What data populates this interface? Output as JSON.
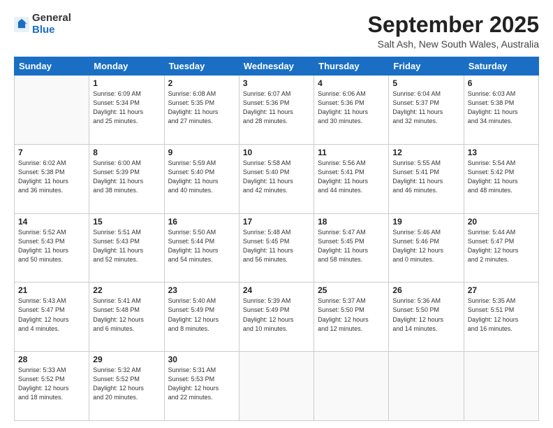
{
  "logo": {
    "general": "General",
    "blue": "Blue"
  },
  "header": {
    "month": "September 2025",
    "location": "Salt Ash, New South Wales, Australia"
  },
  "weekdays": [
    "Sunday",
    "Monday",
    "Tuesday",
    "Wednesday",
    "Thursday",
    "Friday",
    "Saturday"
  ],
  "weeks": [
    [
      {
        "day": "",
        "info": ""
      },
      {
        "day": "1",
        "info": "Sunrise: 6:09 AM\nSunset: 5:34 PM\nDaylight: 11 hours\nand 25 minutes."
      },
      {
        "day": "2",
        "info": "Sunrise: 6:08 AM\nSunset: 5:35 PM\nDaylight: 11 hours\nand 27 minutes."
      },
      {
        "day": "3",
        "info": "Sunrise: 6:07 AM\nSunset: 5:36 PM\nDaylight: 11 hours\nand 28 minutes."
      },
      {
        "day": "4",
        "info": "Sunrise: 6:06 AM\nSunset: 5:36 PM\nDaylight: 11 hours\nand 30 minutes."
      },
      {
        "day": "5",
        "info": "Sunrise: 6:04 AM\nSunset: 5:37 PM\nDaylight: 11 hours\nand 32 minutes."
      },
      {
        "day": "6",
        "info": "Sunrise: 6:03 AM\nSunset: 5:38 PM\nDaylight: 11 hours\nand 34 minutes."
      }
    ],
    [
      {
        "day": "7",
        "info": "Sunrise: 6:02 AM\nSunset: 5:38 PM\nDaylight: 11 hours\nand 36 minutes."
      },
      {
        "day": "8",
        "info": "Sunrise: 6:00 AM\nSunset: 5:39 PM\nDaylight: 11 hours\nand 38 minutes."
      },
      {
        "day": "9",
        "info": "Sunrise: 5:59 AM\nSunset: 5:40 PM\nDaylight: 11 hours\nand 40 minutes."
      },
      {
        "day": "10",
        "info": "Sunrise: 5:58 AM\nSunset: 5:40 PM\nDaylight: 11 hours\nand 42 minutes."
      },
      {
        "day": "11",
        "info": "Sunrise: 5:56 AM\nSunset: 5:41 PM\nDaylight: 11 hours\nand 44 minutes."
      },
      {
        "day": "12",
        "info": "Sunrise: 5:55 AM\nSunset: 5:41 PM\nDaylight: 11 hours\nand 46 minutes."
      },
      {
        "day": "13",
        "info": "Sunrise: 5:54 AM\nSunset: 5:42 PM\nDaylight: 11 hours\nand 48 minutes."
      }
    ],
    [
      {
        "day": "14",
        "info": "Sunrise: 5:52 AM\nSunset: 5:43 PM\nDaylight: 11 hours\nand 50 minutes."
      },
      {
        "day": "15",
        "info": "Sunrise: 5:51 AM\nSunset: 5:43 PM\nDaylight: 11 hours\nand 52 minutes."
      },
      {
        "day": "16",
        "info": "Sunrise: 5:50 AM\nSunset: 5:44 PM\nDaylight: 11 hours\nand 54 minutes."
      },
      {
        "day": "17",
        "info": "Sunrise: 5:48 AM\nSunset: 5:45 PM\nDaylight: 11 hours\nand 56 minutes."
      },
      {
        "day": "18",
        "info": "Sunrise: 5:47 AM\nSunset: 5:45 PM\nDaylight: 11 hours\nand 58 minutes."
      },
      {
        "day": "19",
        "info": "Sunrise: 5:46 AM\nSunset: 5:46 PM\nDaylight: 12 hours\nand 0 minutes."
      },
      {
        "day": "20",
        "info": "Sunrise: 5:44 AM\nSunset: 5:47 PM\nDaylight: 12 hours\nand 2 minutes."
      }
    ],
    [
      {
        "day": "21",
        "info": "Sunrise: 5:43 AM\nSunset: 5:47 PM\nDaylight: 12 hours\nand 4 minutes."
      },
      {
        "day": "22",
        "info": "Sunrise: 5:41 AM\nSunset: 5:48 PM\nDaylight: 12 hours\nand 6 minutes."
      },
      {
        "day": "23",
        "info": "Sunrise: 5:40 AM\nSunset: 5:49 PM\nDaylight: 12 hours\nand 8 minutes."
      },
      {
        "day": "24",
        "info": "Sunrise: 5:39 AM\nSunset: 5:49 PM\nDaylight: 12 hours\nand 10 minutes."
      },
      {
        "day": "25",
        "info": "Sunrise: 5:37 AM\nSunset: 5:50 PM\nDaylight: 12 hours\nand 12 minutes."
      },
      {
        "day": "26",
        "info": "Sunrise: 5:36 AM\nSunset: 5:50 PM\nDaylight: 12 hours\nand 14 minutes."
      },
      {
        "day": "27",
        "info": "Sunrise: 5:35 AM\nSunset: 5:51 PM\nDaylight: 12 hours\nand 16 minutes."
      }
    ],
    [
      {
        "day": "28",
        "info": "Sunrise: 5:33 AM\nSunset: 5:52 PM\nDaylight: 12 hours\nand 18 minutes."
      },
      {
        "day": "29",
        "info": "Sunrise: 5:32 AM\nSunset: 5:52 PM\nDaylight: 12 hours\nand 20 minutes."
      },
      {
        "day": "30",
        "info": "Sunrise: 5:31 AM\nSunset: 5:53 PM\nDaylight: 12 hours\nand 22 minutes."
      },
      {
        "day": "",
        "info": ""
      },
      {
        "day": "",
        "info": ""
      },
      {
        "day": "",
        "info": ""
      },
      {
        "day": "",
        "info": ""
      }
    ]
  ]
}
